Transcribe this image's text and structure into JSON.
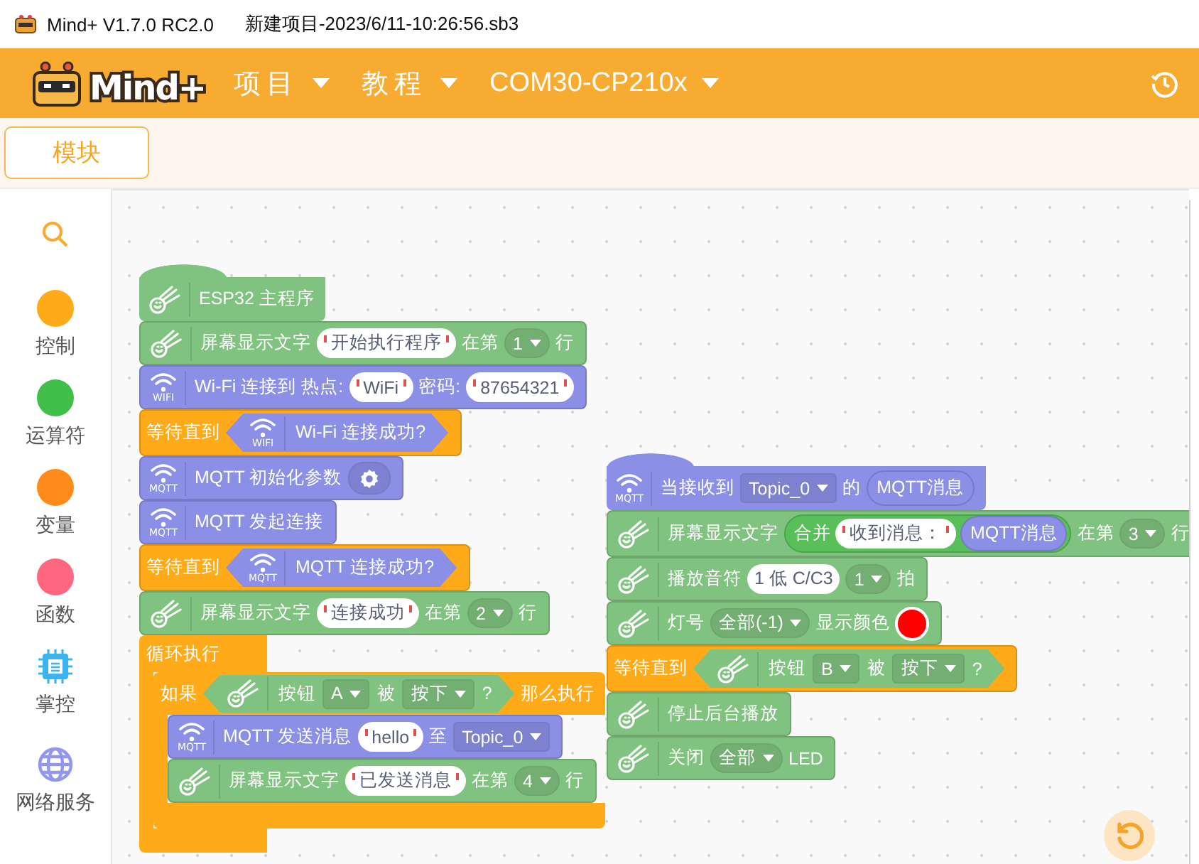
{
  "window": {
    "app_name": "Mind+ V1.7.0 RC2.0",
    "file_name": "新建项目-2023/6/11-10:26:56.sb3"
  },
  "menubar": {
    "logo_text": "Mind+",
    "menus": [
      {
        "label": "项目"
      },
      {
        "label": "教程"
      },
      {
        "label": "COM30-CP210x"
      }
    ]
  },
  "tabs": [
    {
      "label": "模块",
      "selected": true
    }
  ],
  "categories": [
    {
      "kind": "search"
    },
    {
      "kind": "dot",
      "label": "控制",
      "color": "#ffab19"
    },
    {
      "kind": "dot",
      "label": "运算符",
      "color": "#40bf4a"
    },
    {
      "kind": "dot",
      "label": "变量",
      "color": "#ff8c1a"
    },
    {
      "kind": "dot",
      "label": "函数",
      "color": "#ff6680"
    },
    {
      "kind": "chip",
      "label": "掌控"
    },
    {
      "kind": "globe",
      "label": "网络服务"
    }
  ],
  "stacks": [
    {
      "blocks": [
        {
          "kind": "hat",
          "color": "#80c27f",
          "icon": {
            "kind": "comet"
          },
          "parts": [
            {
              "kind": "text",
              "text": "ESP32 主程序"
            }
          ]
        },
        {
          "kind": "stack",
          "color": "#80c27f",
          "icon": {
            "kind": "comet"
          },
          "parts": [
            {
              "kind": "text",
              "text": "屏幕显示文字"
            },
            {
              "kind": "string",
              "text": "开始执行程序"
            },
            {
              "kind": "text",
              "text": "在第"
            },
            {
              "kind": "round_menu",
              "text": "1"
            },
            {
              "kind": "text",
              "text": "行"
            }
          ]
        },
        {
          "kind": "stack",
          "color": "#8c8fe6",
          "icon": {
            "kind": "wifi",
            "label": "WIFI"
          },
          "parts": [
            {
              "kind": "text",
              "text": "Wi-Fi 连接到 热点:"
            },
            {
              "kind": "string",
              "text": "WiFi"
            },
            {
              "kind": "text",
              "text": "密码:"
            },
            {
              "kind": "string",
              "text": "87654321"
            }
          ]
        },
        {
          "kind": "stack",
          "color": "#ffab19",
          "parts": [
            {
              "kind": "text",
              "text": "等待直到"
            },
            {
              "kind": "condition",
              "color": "#8c8fe6",
              "icon": {
                "kind": "wifi",
                "label": "WIFI"
              },
              "parts": [
                {
                  "kind": "text",
                  "text": "Wi-Fi 连接成功?"
                }
              ]
            }
          ]
        },
        {
          "kind": "stack",
          "color": "#8c8fe6",
          "icon": {
            "kind": "wifi",
            "label": "MQTT"
          },
          "parts": [
            {
              "kind": "text",
              "text": "MQTT 初始化参数"
            },
            {
              "kind": "gear"
            }
          ]
        },
        {
          "kind": "stack",
          "color": "#8c8fe6",
          "icon": {
            "kind": "wifi",
            "label": "MQTT"
          },
          "parts": [
            {
              "kind": "text",
              "text": "MQTT 发起连接"
            }
          ]
        },
        {
          "kind": "stack",
          "color": "#ffab19",
          "parts": [
            {
              "kind": "text",
              "text": "等待直到"
            },
            {
              "kind": "condition",
              "color": "#8c8fe6",
              "icon": {
                "kind": "wifi",
                "label": "MQTT"
              },
              "parts": [
                {
                  "kind": "text",
                  "text": "MQTT 连接成功?"
                }
              ]
            }
          ]
        },
        {
          "kind": "stack",
          "color": "#80c27f",
          "icon": {
            "kind": "comet"
          },
          "parts": [
            {
              "kind": "text",
              "text": "屏幕显示文字"
            },
            {
              "kind": "string",
              "text": "连接成功"
            },
            {
              "kind": "text",
              "text": "在第"
            },
            {
              "kind": "round_menu",
              "text": "2"
            },
            {
              "kind": "text",
              "text": "行"
            }
          ]
        },
        {
          "kind": "loop",
          "color": "#ffab19",
          "parts": [
            {
              "kind": "text",
              "text": "循环执行"
            }
          ],
          "body": [
            {
              "kind": "if",
              "color": "#ffab19",
              "parts": [
                {
                  "kind": "text",
                  "text": "如果"
                },
                {
                  "kind": "condition",
                  "color": "#80c27f",
                  "icon": {
                    "kind": "comet"
                  },
                  "parts": [
                    {
                      "kind": "text",
                      "text": "按钮"
                    },
                    {
                      "kind": "square_menu",
                      "text": "A"
                    },
                    {
                      "kind": "text",
                      "text": "被"
                    },
                    {
                      "kind": "square_menu",
                      "text": "按下"
                    },
                    {
                      "kind": "text",
                      "text": "?"
                    }
                  ]
                },
                {
                  "kind": "text",
                  "text": "那么执行"
                }
              ],
              "body": [
                {
                  "kind": "stack",
                  "color": "#8c8fe6",
                  "icon": {
                    "kind": "wifi",
                    "label": "MQTT"
                  },
                  "parts": [
                    {
                      "kind": "text",
                      "text": "MQTT 发送消息"
                    },
                    {
                      "kind": "string",
                      "text": "hello"
                    },
                    {
                      "kind": "text",
                      "text": "至"
                    },
                    {
                      "kind": "square_menu",
                      "text": "Topic_0"
                    }
                  ]
                },
                {
                  "kind": "stack",
                  "color": "#80c27f",
                  "icon": {
                    "kind": "comet"
                  },
                  "parts": [
                    {
                      "kind": "text",
                      "text": "屏幕显示文字"
                    },
                    {
                      "kind": "string",
                      "text": "已发送消息"
                    },
                    {
                      "kind": "text",
                      "text": "在第"
                    },
                    {
                      "kind": "round_menu",
                      "text": "4"
                    },
                    {
                      "kind": "text",
                      "text": "行"
                    }
                  ]
                }
              ]
            }
          ]
        }
      ]
    },
    {
      "blocks": [
        {
          "kind": "hat",
          "color": "#8c8fe6",
          "icon": {
            "kind": "wifi",
            "label": "MQTT"
          },
          "parts": [
            {
              "kind": "text",
              "text": "当接收到"
            },
            {
              "kind": "square_menu",
              "text": "Topic_0"
            },
            {
              "kind": "text",
              "text": "的"
            },
            {
              "kind": "reporter",
              "color": "#8c8fe6",
              "text": "MQTT消息"
            }
          ]
        },
        {
          "kind": "stack",
          "color": "#80c27f",
          "icon": {
            "kind": "comet"
          },
          "parts": [
            {
              "kind": "text",
              "text": "屏幕显示文字"
            },
            {
              "kind": "join",
              "color": "#59c059",
              "parts": [
                {
                  "kind": "text",
                  "text": "合并"
                },
                {
                  "kind": "string",
                  "text": "收到消息："
                },
                {
                  "kind": "reporter",
                  "color": "#8c8fe6",
                  "text": "MQTT消息"
                }
              ]
            },
            {
              "kind": "text",
              "text": "在第"
            },
            {
              "kind": "round_menu",
              "text": "3"
            },
            {
              "kind": "text",
              "text": "行"
            }
          ]
        },
        {
          "kind": "stack",
          "color": "#80c27f",
          "icon": {
            "kind": "comet"
          },
          "parts": [
            {
              "kind": "text",
              "text": "播放音符"
            },
            {
              "kind": "value",
              "text": "1 低 C/C3"
            },
            {
              "kind": "round_menu",
              "text": "1"
            },
            {
              "kind": "text",
              "text": "拍"
            }
          ]
        },
        {
          "kind": "stack",
          "color": "#80c27f",
          "icon": {
            "kind": "comet"
          },
          "parts": [
            {
              "kind": "text",
              "text": "灯号"
            },
            {
              "kind": "round_menu",
              "text": "全部(-1)"
            },
            {
              "kind": "text",
              "text": "显示颜色"
            },
            {
              "kind": "color",
              "color": "#ff0000"
            }
          ]
        },
        {
          "kind": "stack",
          "color": "#ffab19",
          "parts": [
            {
              "kind": "text",
              "text": "等待直到"
            },
            {
              "kind": "condition",
              "color": "#80c27f",
              "icon": {
                "kind": "comet"
              },
              "parts": [
                {
                  "kind": "text",
                  "text": "按钮"
                },
                {
                  "kind": "square_menu",
                  "text": "B"
                },
                {
                  "kind": "text",
                  "text": "被"
                },
                {
                  "kind": "square_menu",
                  "text": "按下"
                },
                {
                  "kind": "text",
                  "text": "?"
                }
              ]
            }
          ]
        },
        {
          "kind": "stack",
          "color": "#80c27f",
          "icon": {
            "kind": "comet"
          },
          "parts": [
            {
              "kind": "text",
              "text": "停止后台播放"
            }
          ]
        },
        {
          "kind": "stack",
          "color": "#80c27f",
          "icon": {
            "kind": "comet"
          },
          "parts": [
            {
              "kind": "text",
              "text": "关闭"
            },
            {
              "kind": "round_menu",
              "text": "全部"
            },
            {
              "kind": "text",
              "text": "LED"
            }
          ]
        }
      ]
    }
  ]
}
